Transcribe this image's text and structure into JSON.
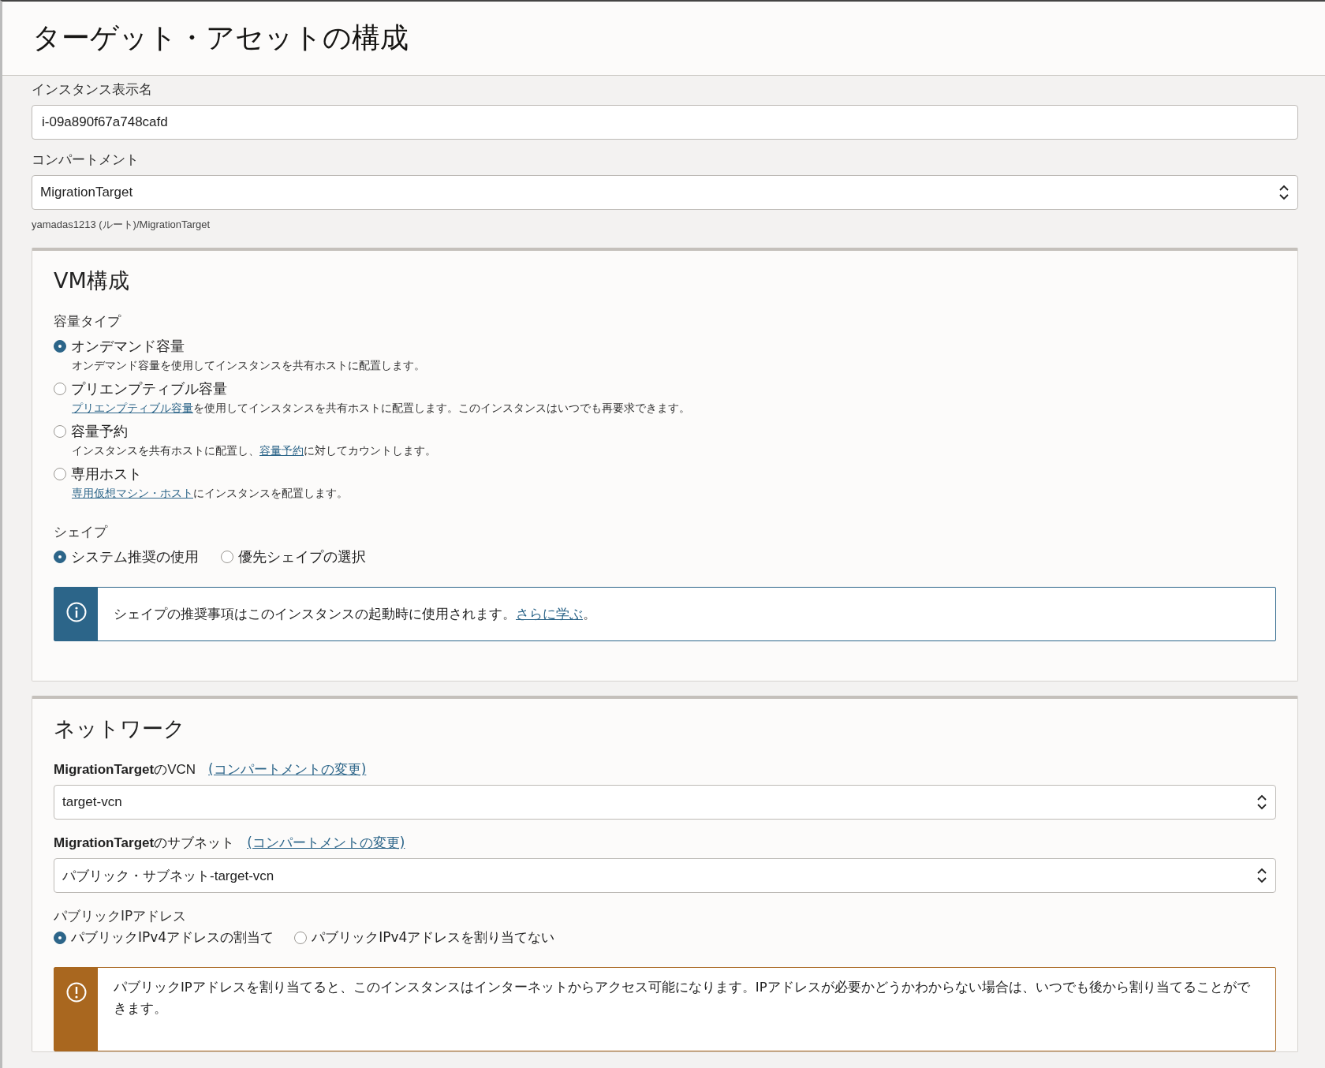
{
  "page_title": "ターゲット・アセットの構成",
  "instance_name": {
    "label": "インスタンス表示名",
    "value": "i-09a890f67a748cafd"
  },
  "compartment": {
    "label": "コンパートメント",
    "value": "MigrationTarget",
    "hint": "yamadas1213 (ルート)/MigrationTarget"
  },
  "vm_section": {
    "title": "VM構成",
    "capacity_type": {
      "label": "容量タイプ",
      "options": [
        {
          "label": "オンデマンド容量",
          "selected": true,
          "description": [
            {
              "kind": "text",
              "text": "オンデマンド容量を使用してインスタンスを共有ホストに配置します。"
            }
          ]
        },
        {
          "label": "プリエンプティブル容量",
          "selected": false,
          "description": [
            {
              "kind": "link",
              "text": "プリエンプティブル容量"
            },
            {
              "kind": "text",
              "text": "を使用してインスタンスを共有ホストに配置します。このインスタンスはいつでも再要求できます。"
            }
          ]
        },
        {
          "label": "容量予約",
          "selected": false,
          "description": [
            {
              "kind": "text",
              "text": "インスタンスを共有ホストに配置し、"
            },
            {
              "kind": "link",
              "text": "容量予約"
            },
            {
              "kind": "text",
              "text": "に対してカウントします。"
            }
          ]
        },
        {
          "label": "専用ホスト",
          "selected": false,
          "description": [
            {
              "kind": "link",
              "text": "専用仮想マシン・ホスト"
            },
            {
              "kind": "text",
              "text": "にインスタンスを配置します。"
            }
          ]
        }
      ]
    },
    "shape": {
      "label": "シェイプ",
      "options": [
        {
          "label": "システム推奨の使用",
          "selected": true
        },
        {
          "label": "優先シェイプの選択",
          "selected": false
        }
      ]
    },
    "notice": {
      "kind": "info",
      "text": "シェイプの推奨事項はこのインスタンスの起動時に使用されます。",
      "link": "さらに学ぶ",
      "after": "。"
    }
  },
  "network_section": {
    "title": "ネットワーク",
    "vcn": {
      "label": "**MigrationTarget**のVCN",
      "link": "(コンパートメントの変更)",
      "value": "target-vcn"
    },
    "subnet": {
      "label": "**MigrationTarget**のサブネット",
      "link": "(コンパートメントの変更)",
      "value": "パブリック・サブネット-target-vcn"
    },
    "public_ip": {
      "label": "パブリックIPアドレス",
      "options": [
        {
          "label": "パブリックIPv4アドレスの割当て",
          "selected": true
        },
        {
          "label": "パブリックIPv4アドレスを割り当てない",
          "selected": false
        }
      ]
    },
    "notice": {
      "kind": "warning",
      "text": "パブリックIPアドレスを割り当てると、このインスタンスはインターネットからアクセス可能になります。IPアドレスが必要かどうかわからない場合は、いつでも後から割り当てることができます。"
    }
  }
}
